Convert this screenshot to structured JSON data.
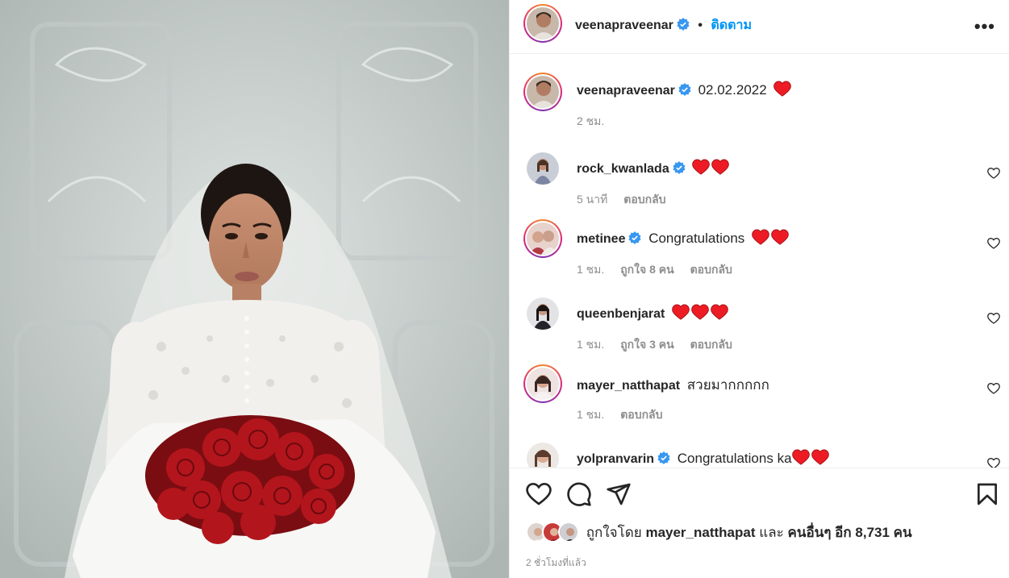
{
  "post": {
    "author": "veenapraveenar",
    "dot": "•",
    "follow_label": "ติดตาม",
    "more_label": "•••",
    "caption": "02.02.2022",
    "caption_time": "2 ชม."
  },
  "comments": [
    {
      "user": "rock_kwanlada",
      "verified": true,
      "text": "",
      "hearts": 2,
      "time": "5 นาที",
      "likes": "",
      "reply": "ตอบกลับ"
    },
    {
      "user": "metinee",
      "verified": true,
      "text": "Congratulations",
      "hearts": 2,
      "time": "1 ชม.",
      "likes": "ถูกใจ 8 คน",
      "reply": "ตอบกลับ"
    },
    {
      "user": "queenbenjarat",
      "verified": false,
      "text": "",
      "hearts": 3,
      "time": "1 ชม.",
      "likes": "ถูกใจ 3 คน",
      "reply": "ตอบกลับ"
    },
    {
      "user": "mayer_natthapat",
      "verified": false,
      "text": "สวยมากกกกก",
      "hearts": 0,
      "time": "1 ชม.",
      "likes": "",
      "reply": "ตอบกลับ"
    },
    {
      "user": "yolpranvarin",
      "verified": true,
      "text": "Congratulations ka",
      "hearts": 2,
      "time": "",
      "likes": "",
      "reply": ""
    }
  ],
  "likes": {
    "prefix": "ถูกใจโดย",
    "first_user": "mayer_natthapat",
    "and": "และ",
    "others": "คนอื่นๆ อีก 8,731 คน"
  },
  "time_ago": "2 ชั่วโมงที่แล้ว",
  "colors": {
    "verified": "#3897f0",
    "heart": "#ed1c24",
    "link": "#0095f6",
    "muted": "#8e8e8e"
  }
}
